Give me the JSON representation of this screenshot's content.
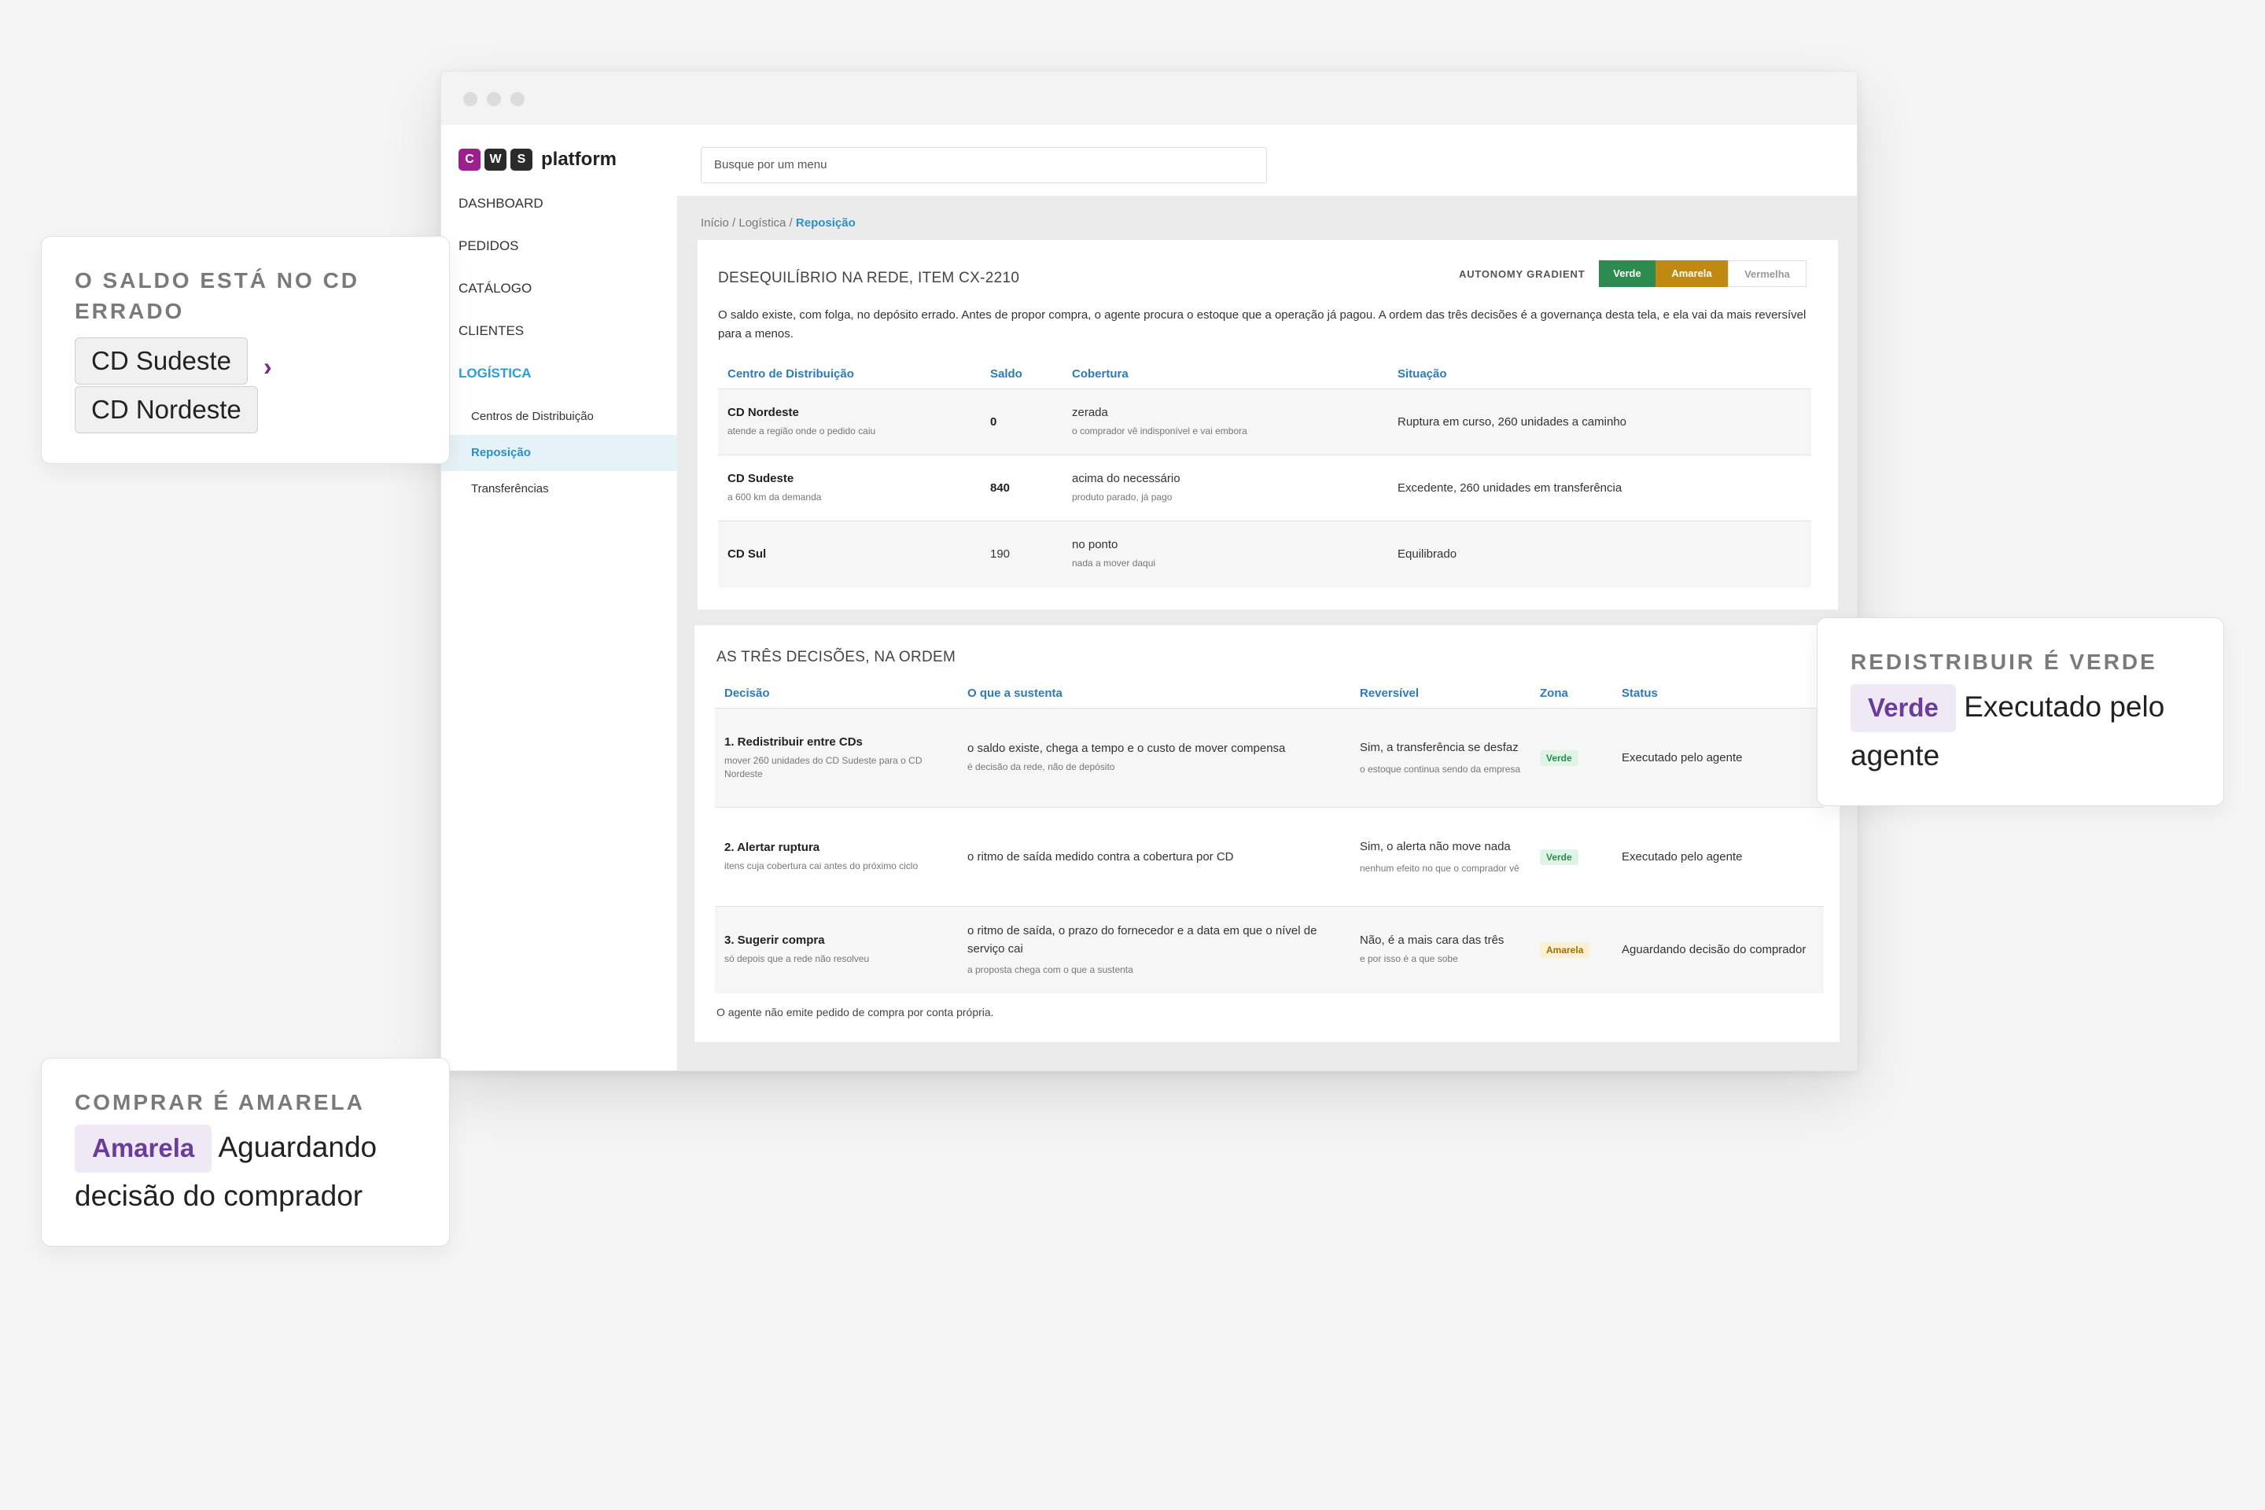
{
  "app": {
    "logo_letters": [
      "C",
      "W",
      "S"
    ],
    "logo_colors": [
      "#9c1f8f",
      "#2b2b2b",
      "#2b2b2b"
    ],
    "logo_text": "platform",
    "search_placeholder": "Busque por um menu"
  },
  "sidebar": {
    "items": [
      {
        "label": "DASHBOARD"
      },
      {
        "label": "PEDIDOS"
      },
      {
        "label": "CATÁLOGO"
      },
      {
        "label": "CLIENTES"
      },
      {
        "label": "LOGÍSTICA",
        "active": true
      }
    ],
    "subitems": [
      {
        "label": "Centros de Distribuição"
      },
      {
        "label": "Reposição",
        "active": true
      },
      {
        "label": "Transferências"
      }
    ]
  },
  "breadcrumb": {
    "part1": "Início / Logística / ",
    "current": "Reposição"
  },
  "imbalance": {
    "title": "DESEQUILÍBRIO NA REDE, ITEM CX-2210",
    "gradient_label": "AUTONOMY GRADIENT",
    "gradient_buttons": [
      "Verde",
      "Amarela",
      "Vermelha"
    ],
    "gradient_colors": {
      "verde": "#2e8b4f",
      "amarela": "#c08a12",
      "vermelha_text": "#9a9a9a"
    },
    "description": "O saldo existe, com folga, no depósito errado. Antes de propor compra, o agente procura o estoque que a operação já pagou. A ordem das três decisões é a governança desta tela, e ela vai da mais reversível para a menos.",
    "headers": [
      "Centro de Distribuição",
      "Saldo",
      "Cobertura",
      "Situação"
    ],
    "rows": [
      {
        "cd": "CD Nordeste",
        "cd_sub": "atende a região onde o pedido caiu",
        "saldo": "0",
        "cobertura": "zerada",
        "cobertura_sub": "o comprador vê indisponível e vai embora",
        "situacao": "Ruptura em curso, 260 unidades a caminho"
      },
      {
        "cd": "CD Sudeste",
        "cd_sub": "a 600 km da demanda",
        "saldo": "840",
        "cobertura": "acima do necessário",
        "cobertura_sub": "produto parado, já pago",
        "situacao": "Excedente, 260 unidades em transferência"
      },
      {
        "cd": "CD Sul",
        "cd_sub": "",
        "saldo": "190",
        "cobertura": "no ponto",
        "cobertura_sub": "nada a mover daqui",
        "situacao": "Equilibrado"
      }
    ]
  },
  "decisions": {
    "title": "AS TRÊS DECISÕES, NA ORDEM",
    "headers": [
      "Decisão",
      "O que a sustenta",
      "Reversível",
      "Zona",
      "Status"
    ],
    "rows": [
      {
        "decisao": "1. Redistribuir entre CDs",
        "decisao_sub": "mover 260 unidades do CD Sudeste para o CD Nordeste",
        "sustenta": "o saldo existe, chega a tempo e o custo de mover compensa",
        "sustenta_sub": "é decisão da rede, não de depósito",
        "reversivel": "Sim, a transferência se desfaz",
        "reversivel_sub": "o estoque continua sendo da empresa",
        "zona": "Verde",
        "status": "Executado pelo agente"
      },
      {
        "decisao": "2. Alertar ruptura",
        "decisao_sub": "itens cuja cobertura cai antes do próximo ciclo",
        "sustenta": "o ritmo de saída medido contra a cobertura por CD",
        "sustenta_sub": "",
        "reversivel": "Sim, o alerta não move nada",
        "reversivel_sub": "nenhum efeito no que o comprador vê",
        "zona": "Verde",
        "status": "Executado pelo agente"
      },
      {
        "decisao": "3. Sugerir compra",
        "decisao_sub": "só depois que a rede não resolveu",
        "sustenta": "o ritmo de saída, o prazo do fornecedor e a data em que o nível de serviço cai",
        "sustenta_sub": "a proposta chega com o que a sustenta",
        "reversivel": "Não, é a mais cara das três",
        "reversivel_sub": "e por isso é a que sobe",
        "zona": "Amarela",
        "status": "Aguardando decisão do comprador"
      }
    ],
    "footnote": "O agente não emite pedido de compra por conta própria."
  },
  "callouts": {
    "saldo": {
      "title": "O SALDO ESTÁ NO CD ERRADO",
      "from": "CD Sudeste",
      "to": "CD Nordeste"
    },
    "redistribuir": {
      "title": "REDISTRIBUIR É VERDE",
      "pill": "Verde",
      "text": "Executado pelo agente"
    },
    "comprar": {
      "title": "COMPRAR É AMARELA",
      "pill": "Amarela",
      "text": "Aguardando decisão do comprador"
    }
  }
}
